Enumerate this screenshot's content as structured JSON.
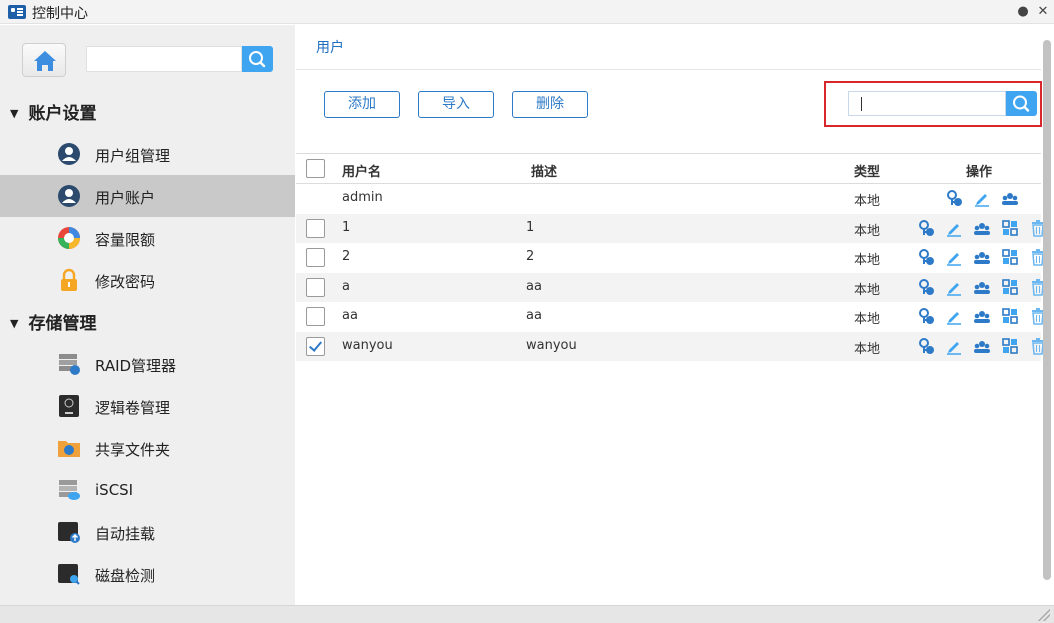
{
  "window": {
    "title": "控制中心"
  },
  "sidebar": {
    "search_placeholder": "",
    "sections": [
      {
        "label": "账户设置",
        "items": [
          {
            "label": "用户组管理",
            "icon": "user-group-icon"
          },
          {
            "label": "用户账户",
            "icon": "user-account-icon",
            "active": true
          },
          {
            "label": "容量限额",
            "icon": "quota-icon"
          },
          {
            "label": "修改密码",
            "icon": "lock-icon"
          }
        ]
      },
      {
        "label": "存储管理",
        "items": [
          {
            "label": "RAID管理器",
            "icon": "raid-icon"
          },
          {
            "label": "逻辑卷管理",
            "icon": "logical-volume-icon"
          },
          {
            "label": "共享文件夹",
            "icon": "shared-folder-icon"
          },
          {
            "label": "iSCSI",
            "icon": "iscsi-icon"
          },
          {
            "label": "自动挂载",
            "icon": "auto-mount-icon"
          },
          {
            "label": "磁盘检测",
            "icon": "disk-check-icon"
          }
        ]
      }
    ]
  },
  "main": {
    "breadcrumb": "用户",
    "toolbar": {
      "add_label": "添加",
      "import_label": "导入",
      "delete_label": "删除"
    },
    "search": {
      "value": "",
      "placeholder": ""
    },
    "table": {
      "headers": {
        "username": "用户名",
        "description": "描述",
        "type": "类型",
        "actions": "操作"
      },
      "rows": [
        {
          "username": "admin",
          "description": "",
          "type": "本地",
          "checkbox": false,
          "checked": false
        },
        {
          "username": "1",
          "description": "1",
          "type": "本地",
          "checkbox": true,
          "checked": false
        },
        {
          "username": "2",
          "description": "2",
          "type": "本地",
          "checkbox": true,
          "checked": false
        },
        {
          "username": "a",
          "description": "aa",
          "type": "本地",
          "checkbox": true,
          "checked": false
        },
        {
          "username": "aa",
          "description": "aa",
          "type": "本地",
          "checkbox": true,
          "checked": false
        },
        {
          "username": "wanyou",
          "description": "wanyou",
          "type": "本地",
          "checkbox": true,
          "checked": true
        }
      ]
    }
  },
  "colors": {
    "accent": "#2d7ac8",
    "search_button": "#3fa5f0",
    "highlight": "#d9262b"
  }
}
